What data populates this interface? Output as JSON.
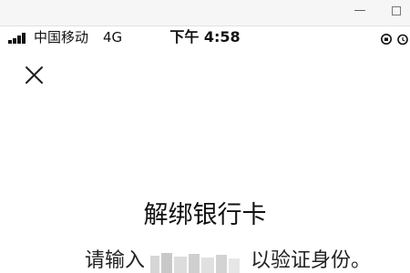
{
  "status_bar": {
    "carrier": "中国移动",
    "network": "4G",
    "time": "下午 4:58"
  },
  "dialog": {
    "title": "解绑银行卡",
    "prompt_prefix": "请输入",
    "prompt_suffix": "以验证身份。"
  },
  "icons": {
    "close": "close-icon",
    "signal": "signal-strength-icon",
    "orientation_lock": "orientation-lock-icon",
    "alarm": "alarm-icon"
  },
  "colors": {
    "background": "#ffffff",
    "text": "#111111",
    "chrome": "#f6f6f6"
  }
}
